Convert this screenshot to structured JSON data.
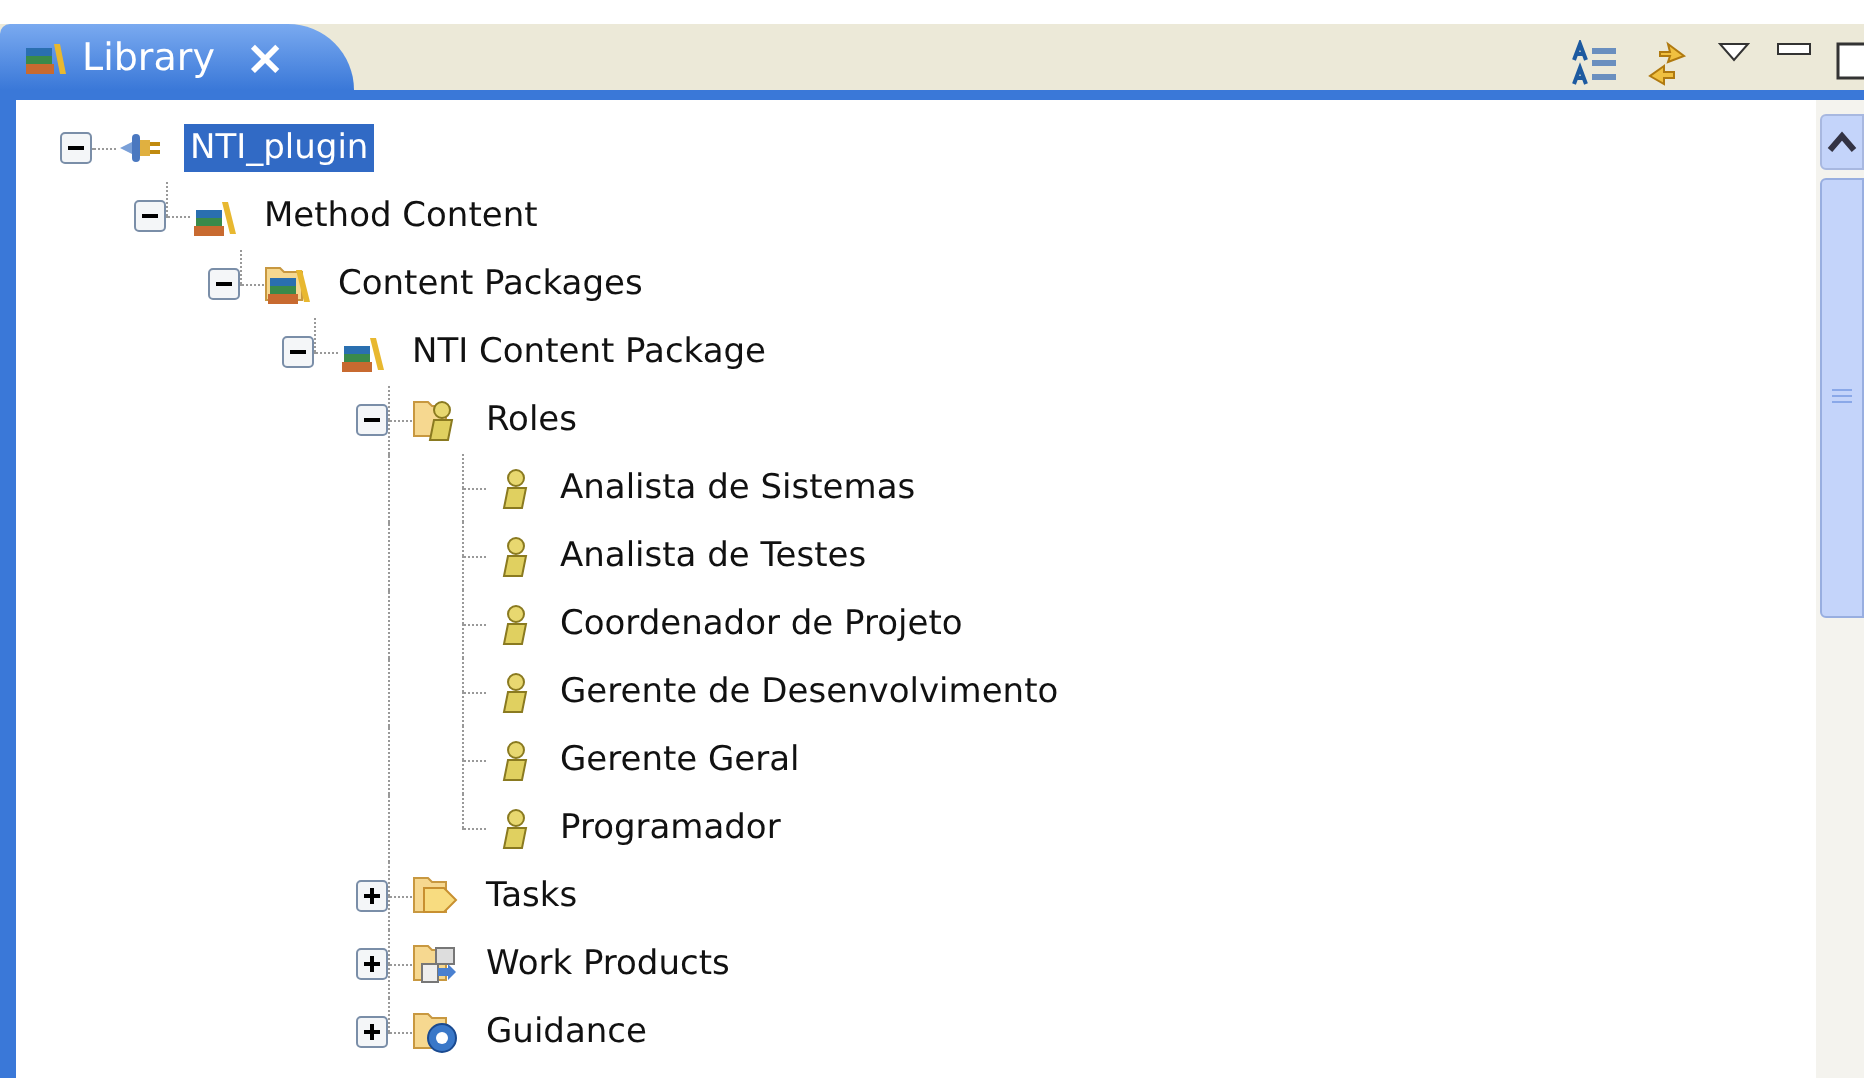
{
  "view_tab": {
    "title": "Library",
    "close": "×",
    "selected": true
  },
  "tree": [
    {
      "label": "NTI_plugin",
      "kind": "plugin",
      "selected": true,
      "expanded": true,
      "children": [
        {
          "label": "Method Content",
          "kind": "library",
          "selected": false,
          "expanded": true,
          "children": [
            {
              "label": "Content Packages",
              "kind": "folder-library",
              "selected": false,
              "expanded": true,
              "children": [
                {
                  "label": "NTI Content Package",
                  "kind": "library",
                  "selected": false,
                  "expanded": true,
                  "children": [
                    {
                      "label": "Roles",
                      "kind": "folder-role",
                      "selected": false,
                      "expanded": true,
                      "children": [
                        {
                          "label": "Analista de Sistemas",
                          "kind": "role",
                          "selected": false
                        },
                        {
                          "label": "Analista de Testes",
                          "kind": "role",
                          "selected": false
                        },
                        {
                          "label": "Coordenador de Projeto",
                          "kind": "role",
                          "selected": false
                        },
                        {
                          "label": "Gerente de Desenvolvimento",
                          "kind": "role",
                          "selected": false
                        },
                        {
                          "label": "Gerente Geral",
                          "kind": "role",
                          "selected": false
                        },
                        {
                          "label": "Programador",
                          "kind": "role",
                          "selected": false
                        }
                      ]
                    },
                    {
                      "label": "Tasks",
                      "kind": "folder-task",
                      "selected": false,
                      "expanded": false
                    },
                    {
                      "label": "Work Products",
                      "kind": "folder-workproduct",
                      "selected": false,
                      "expanded": false
                    },
                    {
                      "label": "Guidance",
                      "kind": "folder-guidance",
                      "selected": false,
                      "expanded": false
                    }
                  ]
                }
              ]
            }
          ]
        }
      ]
    }
  ]
}
